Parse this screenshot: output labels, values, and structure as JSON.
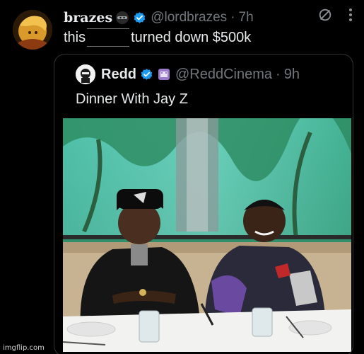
{
  "tweet": {
    "display_name": "brazes",
    "handle": "@lordbrazes",
    "separator": "·",
    "time": "7h",
    "text_before": "this",
    "text_after": "turned down $500k",
    "emoji_icon": "ninja-emoji",
    "verified_color": "#1d9bf0"
  },
  "quote": {
    "display_name": "Redd",
    "handle": "@ReddCinema",
    "separator": "·",
    "time": "9h",
    "text": "Dinner With Jay Z",
    "emoji_icon": "cinema-emoji",
    "verified_color": "#1d9bf0"
  },
  "actions": {
    "icons": [
      "no-entry-icon",
      "more-options-icon"
    ]
  },
  "watermark": "imgflip.com",
  "colors": {
    "background": "#000000",
    "primary_text": "#e7e9ea",
    "secondary_text": "#71767b",
    "card_border": "#2f3336"
  }
}
